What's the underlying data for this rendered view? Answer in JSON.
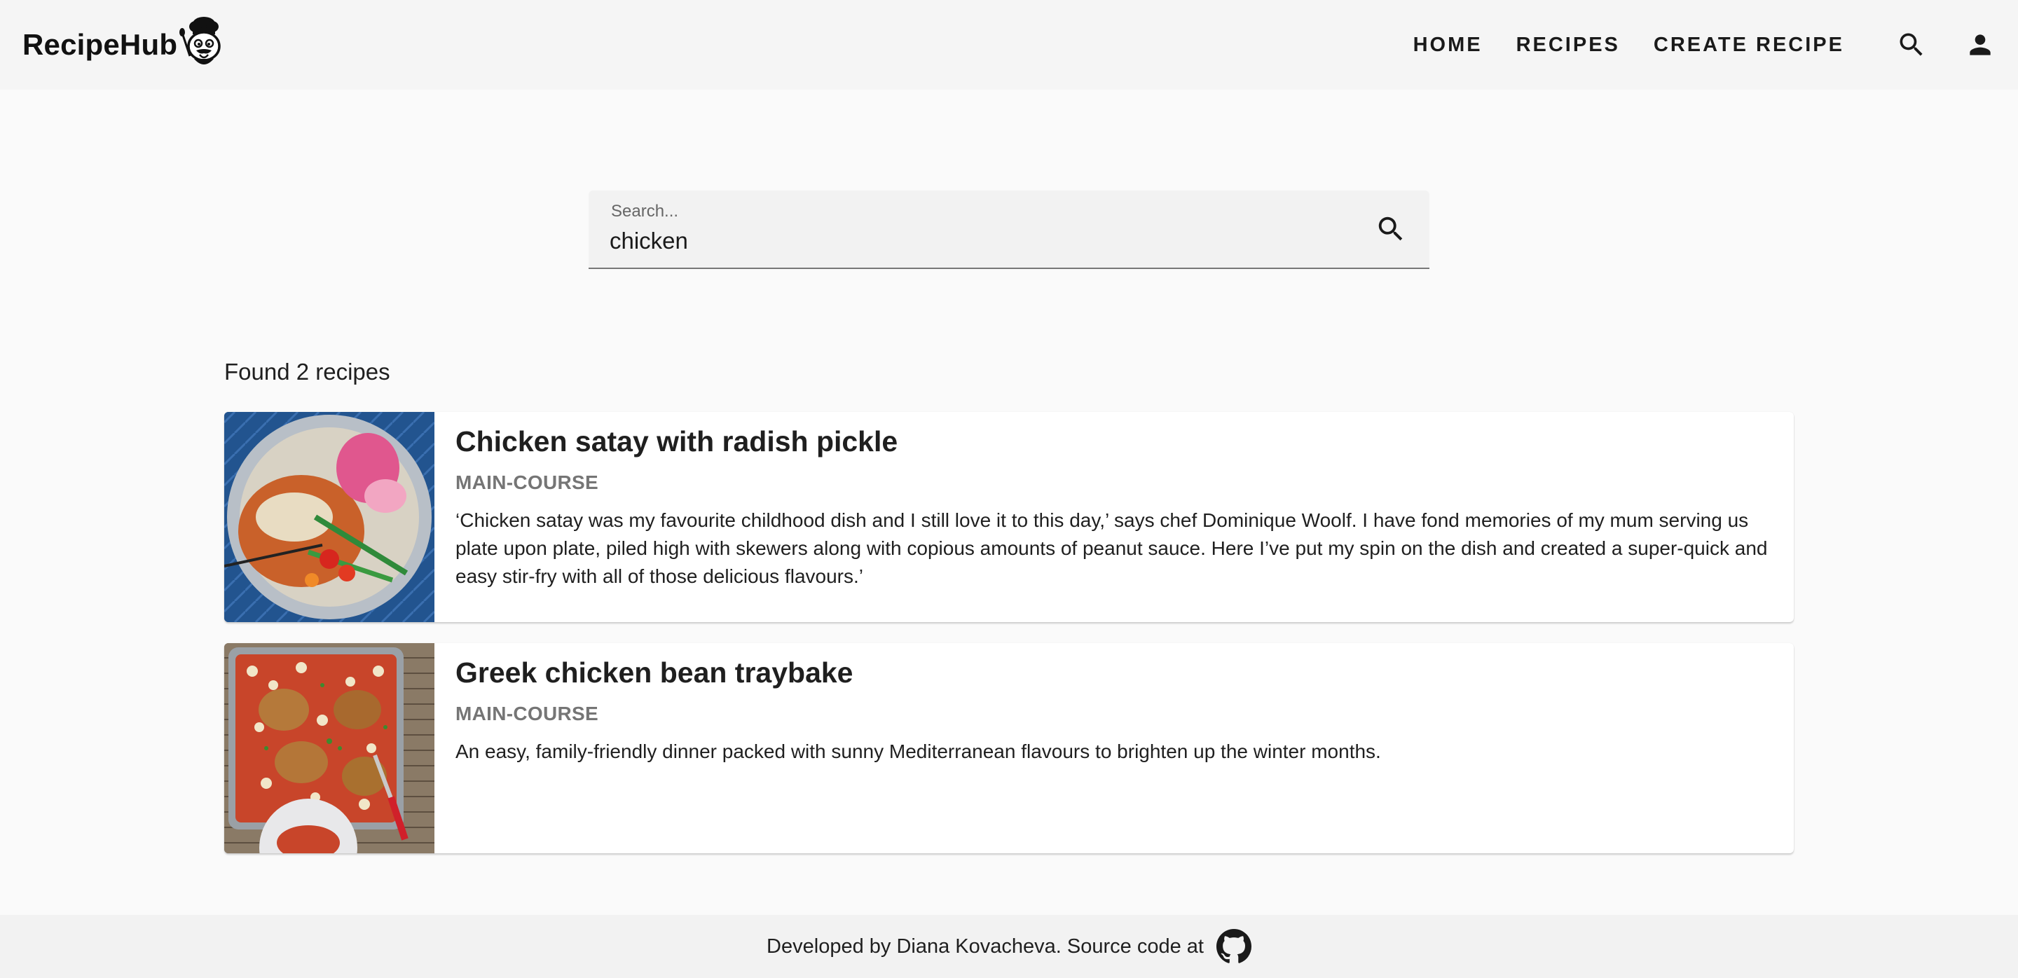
{
  "brand": {
    "name": "RecipeHub",
    "logo_icon": "chef-mascot-icon"
  },
  "nav": {
    "links": [
      {
        "label": "HOME"
      },
      {
        "label": "RECIPES"
      },
      {
        "label": "CREATE RECIPE"
      }
    ],
    "icons": [
      "search-icon",
      "account-icon"
    ]
  },
  "search": {
    "label": "Search...",
    "value": "chicken",
    "button_icon": "search-icon"
  },
  "results": {
    "summary": "Found 2 recipes",
    "items": [
      {
        "title": "Chicken satay with radish pickle",
        "category": "MAIN-COURSE",
        "description": "‘Chicken satay was my favourite childhood dish and I still love it to this day,’ says chef Dominique Woolf. I have fond memories of my mum serving us plate upon plate, piled high with skewers along with copious amounts of peanut sauce. Here I’ve put my spin on the dish and created a super-quick and easy stir-fry with all of those delicious flavours.’"
      },
      {
        "title": "Greek chicken bean traybake",
        "category": "MAIN-COURSE",
        "description": "An easy, family-friendly dinner packed with sunny Mediterranean flavours to brighten up the winter months."
      }
    ]
  },
  "footer": {
    "text": "Developed by Diana Kovacheva. Source code at",
    "icon": "github-icon"
  },
  "colors": {
    "header_bg": "#f5f5f5",
    "page_bg": "#fafafa",
    "category_text": "#757575"
  }
}
